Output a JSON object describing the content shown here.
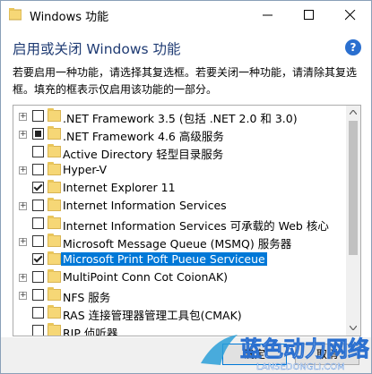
{
  "window": {
    "title": "Windows 功能",
    "heading": "启用或关闭 Windows 功能",
    "description": "若要启用一种功能，请选择其复选框。若要关闭一种功能，请清除其复选框。填充的框表示仅启用该功能的一部分。"
  },
  "features": [
    {
      "label": ".NET Framework 3.5 (包括 .NET 2.0 和 3.0)",
      "state": "unchecked",
      "expandable": true
    },
    {
      "label": ".NET Framework 4.6 高级服务",
      "state": "partial",
      "expandable": true
    },
    {
      "label": "Active Directory 轻型目录服务",
      "state": "unchecked",
      "expandable": false
    },
    {
      "label": "Hyper-V",
      "state": "unchecked",
      "expandable": true
    },
    {
      "label": "Internet Explorer 11",
      "state": "checked",
      "expandable": false
    },
    {
      "label": "Internet Information Services",
      "state": "unchecked",
      "expandable": true
    },
    {
      "label": "Internet Information Services 可承载的 Web 核心",
      "state": "unchecked",
      "expandable": false
    },
    {
      "label": "Microsoft Message Queue (MSMQ) 服务器",
      "state": "unchecked",
      "expandable": true
    },
    {
      "label": "Microsoft Print Poft Pueue Serviceue",
      "state": "checked",
      "expandable": false,
      "selected": true
    },
    {
      "label": "MultiPoint Conn Cot CoionAK)",
      "state": "unchecked",
      "expandable": true
    },
    {
      "label": "NFS 服务",
      "state": "unchecked",
      "expandable": true
    },
    {
      "label": "RAS 连接管理器管理工具包(CMAK)",
      "state": "unchecked",
      "expandable": false
    },
    {
      "label": "RIP 侦听器",
      "state": "unchecked",
      "expandable": false
    }
  ],
  "buttons": {
    "ok": "确定",
    "cancel": "取消"
  },
  "watermark": {
    "text": "蓝色动力网络",
    "subtext": "LANSEDONGLI.COM"
  },
  "colors": {
    "heading": "#1f3b73",
    "selection": "#0078d7",
    "folder": "#f6d776"
  }
}
